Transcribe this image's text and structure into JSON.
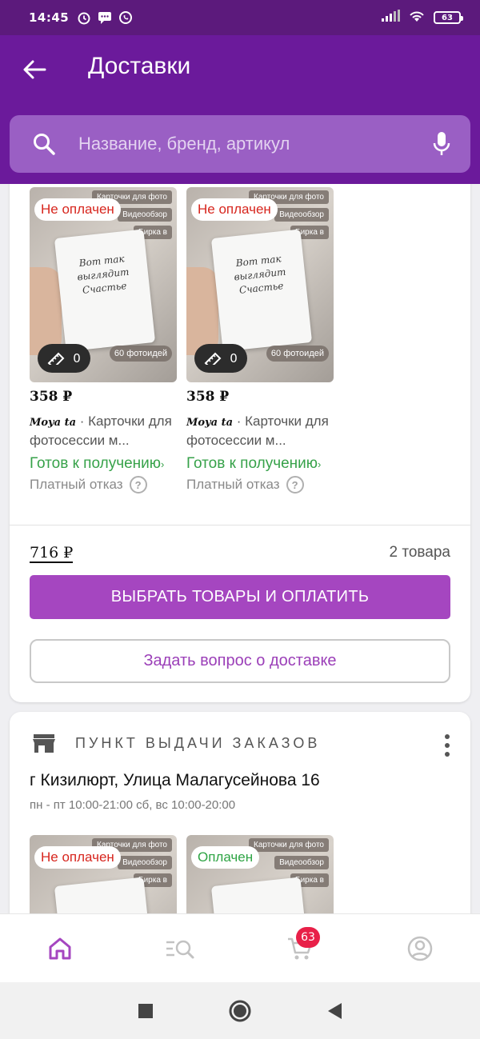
{
  "status_bar": {
    "time": "14:45",
    "battery": "63"
  },
  "header": {
    "title": "Доставки",
    "search_placeholder": "Название, бренд, артикул"
  },
  "delivery1": {
    "products": [
      {
        "status": "Не оплачен",
        "price": "358 ₽",
        "brand": "Moya ta",
        "name": "Карточки для фотосессии м...",
        "ready": "Готов к получению",
        "refusal": "Платный отказ",
        "ruler_count": "0",
        "ribbon_top": "Карточки для фото",
        "ribbon_mid": "Видеообзор",
        "ribbon_low": "Бирка в",
        "count_badge": "60 фотоидей",
        "card_text": "Вот так выглядит Счастье"
      },
      {
        "status": "Не оплачен",
        "price": "358 ₽",
        "brand": "Moya ta",
        "name": "Карточки для фотосессии м...",
        "ready": "Готов к получению",
        "refusal": "Платный отказ",
        "ruler_count": "0",
        "ribbon_top": "Карточки для фото",
        "ribbon_mid": "Видеообзор",
        "ribbon_low": "Бирка в",
        "count_badge": "60 фотоидей",
        "card_text": "Вот так выглядит Счастье"
      }
    ],
    "total": "716 ₽",
    "items_count": "2 товара",
    "pay_button": "ВЫБРАТЬ ТОВАРЫ И ОПЛАТИТЬ",
    "ask_button": "Задать вопрос о доставке"
  },
  "delivery2": {
    "pickup_label": "ПУНКТ ВЫДАЧИ ЗАКАЗОВ",
    "address": "г Кизилюрт, Улица Малагусейнова 16",
    "hours": "пн - пт 10:00-21:00 сб, вс 10:00-20:00",
    "products": [
      {
        "status": "Не оплачен",
        "ribbon_top": "Карточки для фото",
        "ribbon_mid": "Видеообзор",
        "ribbon_low": "Бирка в"
      },
      {
        "status": "Оплачен",
        "ribbon_top": "Карточки для фото",
        "ribbon_mid": "Видеообзор",
        "ribbon_low": "Бирка в"
      }
    ]
  },
  "bottom_nav": {
    "cart_badge": "63"
  },
  "colors": {
    "header": "#6b1a9b",
    "accent": "#a546c0",
    "unpaid": "#d7261e",
    "paid": "#2ea444",
    "ready": "#37a24a"
  }
}
